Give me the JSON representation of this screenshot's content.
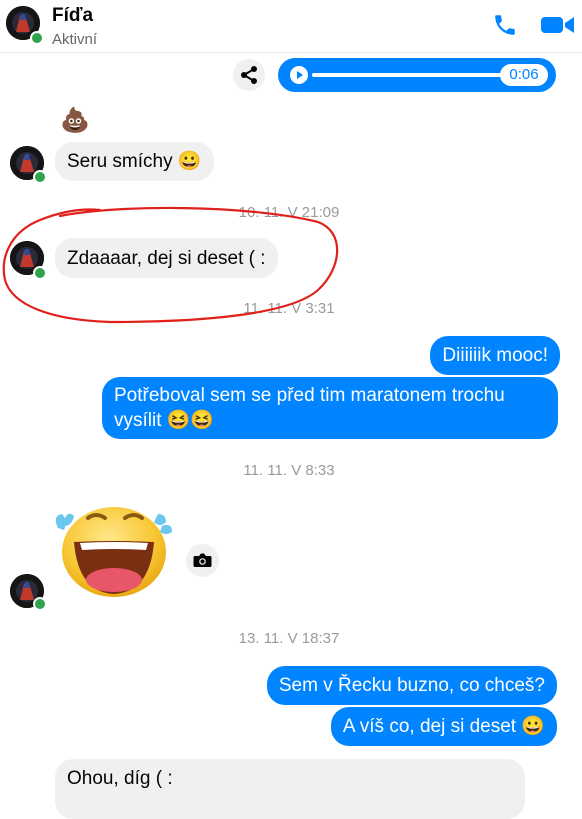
{
  "header": {
    "contact_name": "Fíďa",
    "status": "Aktivní",
    "call_icon": "phone-icon",
    "video_icon": "video-camera-icon",
    "accent_color": "#0084ff"
  },
  "audio_message": {
    "duration": "0:06"
  },
  "messages": [
    {
      "type": "emoji",
      "from": "contact",
      "content": "💩"
    },
    {
      "type": "text",
      "from": "contact",
      "text": "Seru smíchy 😀"
    },
    {
      "type": "timestamp",
      "text": "10. 11. V 21:09"
    },
    {
      "type": "text",
      "from": "contact",
      "text": "Zdaaaar, dej si deset ( :"
    },
    {
      "type": "timestamp",
      "text": "11. 11. V 3:31"
    },
    {
      "type": "text",
      "from": "me",
      "text": "Diiiiiik mooc!"
    },
    {
      "type": "text",
      "from": "me",
      "lines": [
        "Potřeboval sem se před tim maratonem trochu",
        "vysílit 😆😆"
      ]
    },
    {
      "type": "timestamp",
      "text": "11. 11. V 8:33"
    },
    {
      "type": "sticker",
      "from": "contact",
      "content": "laughing-tears-sticker"
    },
    {
      "type": "timestamp",
      "text": "13. 11. V 18:37"
    },
    {
      "type": "text",
      "from": "me",
      "text": "Sem v Řecku buzno, co chceš?"
    },
    {
      "type": "text",
      "from": "me",
      "text": "A víš co, dej si deset 😀"
    },
    {
      "type": "text",
      "from": "contact",
      "text": "Ohou, díg ( :"
    }
  ],
  "annotation_color": "#e0201b"
}
